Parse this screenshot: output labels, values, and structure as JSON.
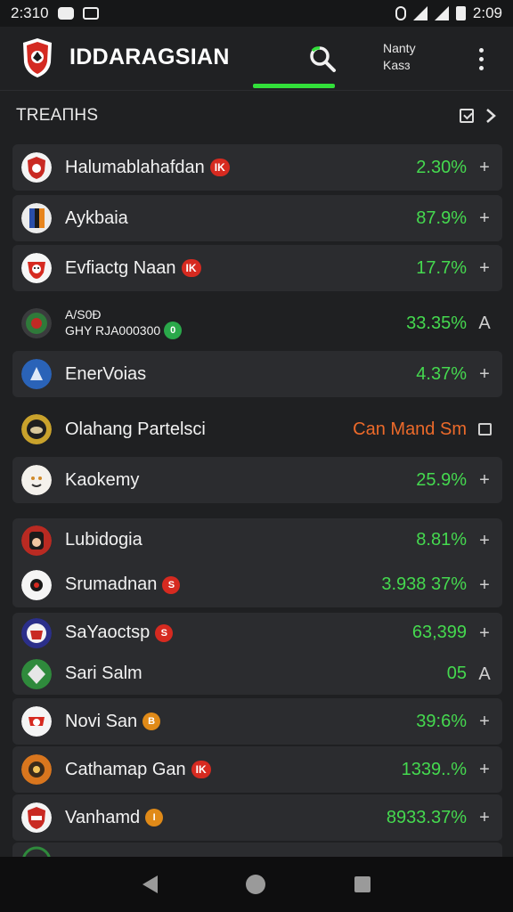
{
  "status_bar": {
    "time": "2:310",
    "clock": "2:09"
  },
  "header": {
    "title": "IDDARAGSIAN",
    "account_line1": "Nanty",
    "account_line2": "Kasɜ"
  },
  "section": {
    "title": "TREAΠHS"
  },
  "rows": [
    {
      "name": "Halumablahafdan",
      "tag": "IK",
      "value": "2.30%",
      "action": "+"
    },
    {
      "name": "Aykbaia",
      "tag": "",
      "value": "87.9%",
      "action": "+"
    },
    {
      "name": "Evfiactg Naan",
      "tag": "IK",
      "value": "17.7%",
      "action": "+"
    },
    {
      "name": "A/S0Ð",
      "sub": "GHY RJA000300",
      "tag": "0",
      "value": "33.35%",
      "action": "A"
    },
    {
      "name": "EnerVoias",
      "tag": "",
      "value": "4.37%",
      "action": "+"
    },
    {
      "name": "Olahang Partelsci",
      "tag": "",
      "value": "Can Mand Sm",
      "action": "box"
    },
    {
      "name": "Kaokemy",
      "tag": "",
      "value": "25.9%",
      "action": "+"
    },
    {
      "name": "Lubidogia",
      "tag": "",
      "value": "8.81%",
      "action": "+"
    },
    {
      "name": "Srumadnan",
      "tag": "S",
      "value": "3.938 37%",
      "action": "+"
    },
    {
      "name": "SaYaoctsp",
      "tag": "S",
      "value": "63,399",
      "action": "+"
    },
    {
      "name": "Sari Salm",
      "tag": "",
      "value": "05",
      "action": "A"
    },
    {
      "name": "Novi San",
      "tag": "B",
      "value": "39:6%",
      "action": "+"
    },
    {
      "name": "Cathamap Gan",
      "tag": "IK",
      "value": "1339..%",
      "action": "+"
    },
    {
      "name": "Vanhamd",
      "tag": "I",
      "value": "8933.37%",
      "action": "+"
    }
  ],
  "colors": {
    "accent": "#32e03a",
    "positive": "#45d94f",
    "warning": "#ec6a2a",
    "tag_red": "#d62a20"
  }
}
